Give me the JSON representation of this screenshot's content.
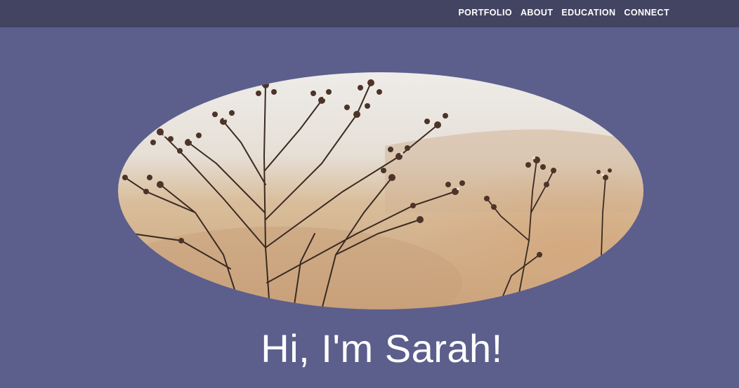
{
  "nav": {
    "items": [
      {
        "label": "PORTFOLIO"
      },
      {
        "label": "ABOUT"
      },
      {
        "label": "EDUCATION"
      },
      {
        "label": "CONNECT"
      }
    ]
  },
  "hero": {
    "image_icon": "dried-flowers-photo",
    "heading": "Hi, I'm Sarah!"
  },
  "colors": {
    "background": "#5c5e8c",
    "navbar": "#434461",
    "text": "#ffffff"
  }
}
